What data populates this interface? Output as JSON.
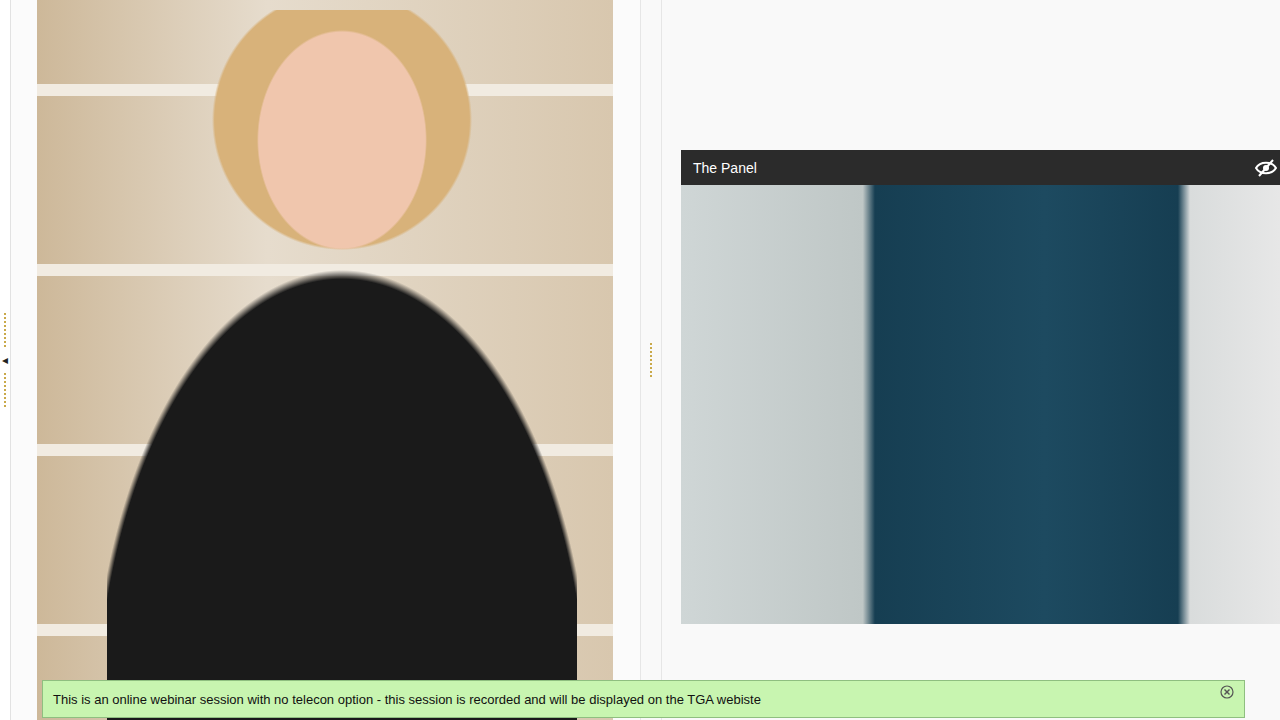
{
  "sidebar_toggle": "◂",
  "panel": {
    "title": "The Panel"
  },
  "banner": {
    "text": "This is an online webinar session with no telecon option - this session is recorded and will be displayed on the TGA webiste"
  }
}
